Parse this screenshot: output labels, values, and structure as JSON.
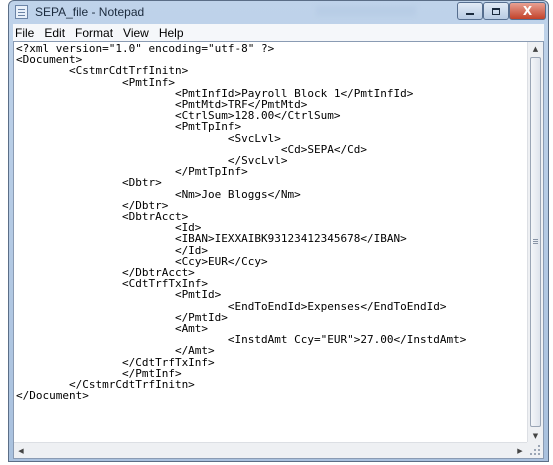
{
  "window": {
    "title": "SEPA_file - Notepad",
    "controls": {
      "minimize_icon": "minimize-icon",
      "maximize_icon": "maximize-icon",
      "close_label": "X"
    }
  },
  "menubar": {
    "items": [
      "File",
      "Edit",
      "Format",
      "View",
      "Help"
    ]
  },
  "editor": {
    "lines": [
      "<?xml version=\"1.0\" encoding=\"utf-8\" ?>",
      "<Document>",
      "        <CstmrCdtTrfInitn>",
      "                <PmtInf>",
      "                        <PmtInfId>Payroll Block 1</PmtInfId>",
      "                        <PmtMtd>TRF</PmtMtd>",
      "                        <CtrlSum>128.00</CtrlSum>",
      "                        <PmtTpInf>",
      "                                <SvcLvl>",
      "                                        <Cd>SEPA</Cd>",
      "                                </SvcLvl>",
      "                        </PmtTpInf>",
      "                <Dbtr>",
      "                        <Nm>Joe Bloggs</Nm>",
      "                </Dbtr>",
      "                <DbtrAcct>",
      "                        <Id>",
      "                        <IBAN>IEXXAIBK93123412345678</IBAN>",
      "                        </Id>",
      "                        <Ccy>EUR</Ccy>",
      "                </DbtrAcct>",
      "                <CdtTrfTxInf>",
      "                        <PmtId>",
      "                                <EndToEndId>Expenses</EndToEndId>",
      "                        </PmtId>",
      "                        <Amt>",
      "                                <InstdAmt Ccy=\"EUR\">27.00</InstdAmt>",
      "                        </Amt>",
      "                </CdtTrfTxInf>",
      "                </PmtInf>",
      "        </CstmrCdtTrfInitn>",
      "</Document>"
    ]
  },
  "colors": {
    "titlebar": "#bfd3ea",
    "close_button": "#c2422a",
    "editor_bg": "#ffffff"
  }
}
